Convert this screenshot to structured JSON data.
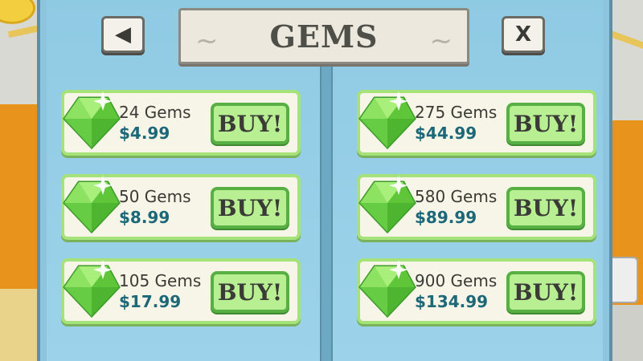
{
  "title": "GEMS",
  "nav": {
    "back_icon": "◀",
    "close_label": "X"
  },
  "offers": [
    {
      "quantity": "24 Gems",
      "price": "$4.99",
      "buy_label": "BUY!"
    },
    {
      "quantity": "275 Gems",
      "price": "$44.99",
      "buy_label": "BUY!"
    },
    {
      "quantity": "50 Gems",
      "price": "$8.99",
      "buy_label": "BUY!"
    },
    {
      "quantity": "580 Gems",
      "price": "$89.99",
      "buy_label": "BUY!"
    },
    {
      "quantity": "105 Gems",
      "price": "$17.99",
      "buy_label": "BUY!"
    },
    {
      "quantity": "900 Gems",
      "price": "$134.99",
      "buy_label": "BUY!"
    }
  ],
  "colors": {
    "panel": "#8ec5de",
    "card_border": "#a6e27a",
    "buy_button": "#b8ef92",
    "price_text": "#1d6878",
    "gem": "#7ed957"
  }
}
